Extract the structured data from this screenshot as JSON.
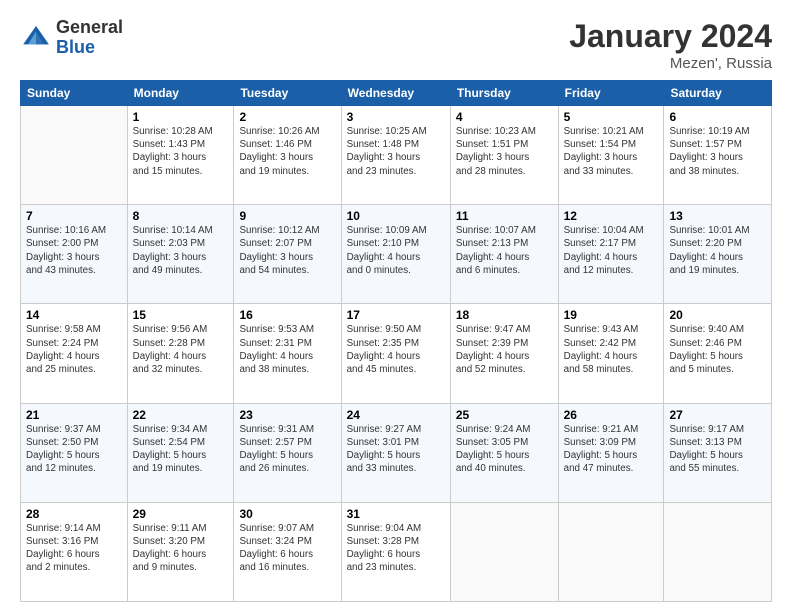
{
  "header": {
    "logo": {
      "general": "General",
      "blue": "Blue"
    },
    "title": "January 2024",
    "location": "Mezen', Russia"
  },
  "calendar": {
    "days_of_week": [
      "Sunday",
      "Monday",
      "Tuesday",
      "Wednesday",
      "Thursday",
      "Friday",
      "Saturday"
    ],
    "weeks": [
      [
        {
          "day": "",
          "info": ""
        },
        {
          "day": "1",
          "info": "Sunrise: 10:28 AM\nSunset: 1:43 PM\nDaylight: 3 hours\nand 15 minutes."
        },
        {
          "day": "2",
          "info": "Sunrise: 10:26 AM\nSunset: 1:46 PM\nDaylight: 3 hours\nand 19 minutes."
        },
        {
          "day": "3",
          "info": "Sunrise: 10:25 AM\nSunset: 1:48 PM\nDaylight: 3 hours\nand 23 minutes."
        },
        {
          "day": "4",
          "info": "Sunrise: 10:23 AM\nSunset: 1:51 PM\nDaylight: 3 hours\nand 28 minutes."
        },
        {
          "day": "5",
          "info": "Sunrise: 10:21 AM\nSunset: 1:54 PM\nDaylight: 3 hours\nand 33 minutes."
        },
        {
          "day": "6",
          "info": "Sunrise: 10:19 AM\nSunset: 1:57 PM\nDaylight: 3 hours\nand 38 minutes."
        }
      ],
      [
        {
          "day": "7",
          "info": "Sunrise: 10:16 AM\nSunset: 2:00 PM\nDaylight: 3 hours\nand 43 minutes."
        },
        {
          "day": "8",
          "info": "Sunrise: 10:14 AM\nSunset: 2:03 PM\nDaylight: 3 hours\nand 49 minutes."
        },
        {
          "day": "9",
          "info": "Sunrise: 10:12 AM\nSunset: 2:07 PM\nDaylight: 3 hours\nand 54 minutes."
        },
        {
          "day": "10",
          "info": "Sunrise: 10:09 AM\nSunset: 2:10 PM\nDaylight: 4 hours\nand 0 minutes."
        },
        {
          "day": "11",
          "info": "Sunrise: 10:07 AM\nSunset: 2:13 PM\nDaylight: 4 hours\nand 6 minutes."
        },
        {
          "day": "12",
          "info": "Sunrise: 10:04 AM\nSunset: 2:17 PM\nDaylight: 4 hours\nand 12 minutes."
        },
        {
          "day": "13",
          "info": "Sunrise: 10:01 AM\nSunset: 2:20 PM\nDaylight: 4 hours\nand 19 minutes."
        }
      ],
      [
        {
          "day": "14",
          "info": "Sunrise: 9:58 AM\nSunset: 2:24 PM\nDaylight: 4 hours\nand 25 minutes."
        },
        {
          "day": "15",
          "info": "Sunrise: 9:56 AM\nSunset: 2:28 PM\nDaylight: 4 hours\nand 32 minutes."
        },
        {
          "day": "16",
          "info": "Sunrise: 9:53 AM\nSunset: 2:31 PM\nDaylight: 4 hours\nand 38 minutes."
        },
        {
          "day": "17",
          "info": "Sunrise: 9:50 AM\nSunset: 2:35 PM\nDaylight: 4 hours\nand 45 minutes."
        },
        {
          "day": "18",
          "info": "Sunrise: 9:47 AM\nSunset: 2:39 PM\nDaylight: 4 hours\nand 52 minutes."
        },
        {
          "day": "19",
          "info": "Sunrise: 9:43 AM\nSunset: 2:42 PM\nDaylight: 4 hours\nand 58 minutes."
        },
        {
          "day": "20",
          "info": "Sunrise: 9:40 AM\nSunset: 2:46 PM\nDaylight: 5 hours\nand 5 minutes."
        }
      ],
      [
        {
          "day": "21",
          "info": "Sunrise: 9:37 AM\nSunset: 2:50 PM\nDaylight: 5 hours\nand 12 minutes."
        },
        {
          "day": "22",
          "info": "Sunrise: 9:34 AM\nSunset: 2:54 PM\nDaylight: 5 hours\nand 19 minutes."
        },
        {
          "day": "23",
          "info": "Sunrise: 9:31 AM\nSunset: 2:57 PM\nDaylight: 5 hours\nand 26 minutes."
        },
        {
          "day": "24",
          "info": "Sunrise: 9:27 AM\nSunset: 3:01 PM\nDaylight: 5 hours\nand 33 minutes."
        },
        {
          "day": "25",
          "info": "Sunrise: 9:24 AM\nSunset: 3:05 PM\nDaylight: 5 hours\nand 40 minutes."
        },
        {
          "day": "26",
          "info": "Sunrise: 9:21 AM\nSunset: 3:09 PM\nDaylight: 5 hours\nand 47 minutes."
        },
        {
          "day": "27",
          "info": "Sunrise: 9:17 AM\nSunset: 3:13 PM\nDaylight: 5 hours\nand 55 minutes."
        }
      ],
      [
        {
          "day": "28",
          "info": "Sunrise: 9:14 AM\nSunset: 3:16 PM\nDaylight: 6 hours\nand 2 minutes."
        },
        {
          "day": "29",
          "info": "Sunrise: 9:11 AM\nSunset: 3:20 PM\nDaylight: 6 hours\nand 9 minutes."
        },
        {
          "day": "30",
          "info": "Sunrise: 9:07 AM\nSunset: 3:24 PM\nDaylight: 6 hours\nand 16 minutes."
        },
        {
          "day": "31",
          "info": "Sunrise: 9:04 AM\nSunset: 3:28 PM\nDaylight: 6 hours\nand 23 minutes."
        },
        {
          "day": "",
          "info": ""
        },
        {
          "day": "",
          "info": ""
        },
        {
          "day": "",
          "info": ""
        }
      ]
    ]
  }
}
